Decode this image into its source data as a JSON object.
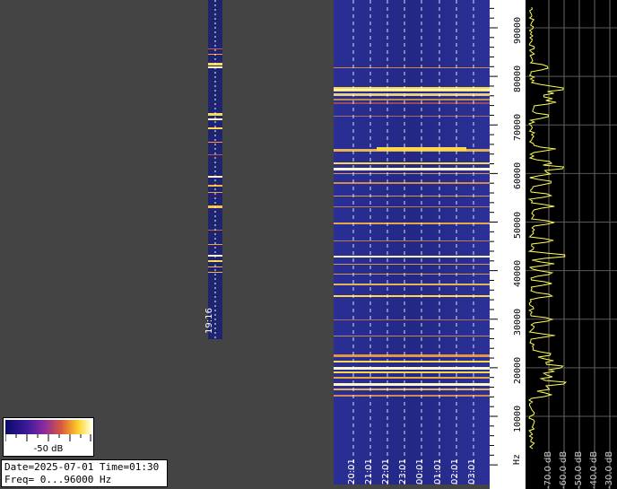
{
  "info": {
    "line1": "Date=2025-07-01 Time=01:30",
    "line2": "Freq= 0...96000 Hz"
  },
  "legend": {
    "label": "-50 dB"
  },
  "narrow_strip": {
    "time_label": "19:16"
  },
  "freq_axis": {
    "unit": "Hz",
    "ticks": [
      "10000",
      "20000",
      "30000",
      "40000",
      "50000",
      "60000",
      "70000",
      "80000",
      "90000"
    ]
  },
  "time_axis": {
    "ticks": [
      "20:01",
      "21:01",
      "22:01",
      "23:01",
      "00:01",
      "01:01",
      "02:01",
      "03:01"
    ]
  },
  "db_axis": {
    "ticks": [
      "-70.0 dB",
      "-60.0 dB",
      "-50.0 dB",
      "-40.0 dB",
      "-30.0 dB"
    ]
  },
  "colors": {
    "background": "#444444",
    "spectrogram_bg": "#262a8a",
    "band": "#ffb43c",
    "band_hot": "#fff6c8",
    "spectrum_line": "#ffff55",
    "grid": "#ffffff"
  }
}
